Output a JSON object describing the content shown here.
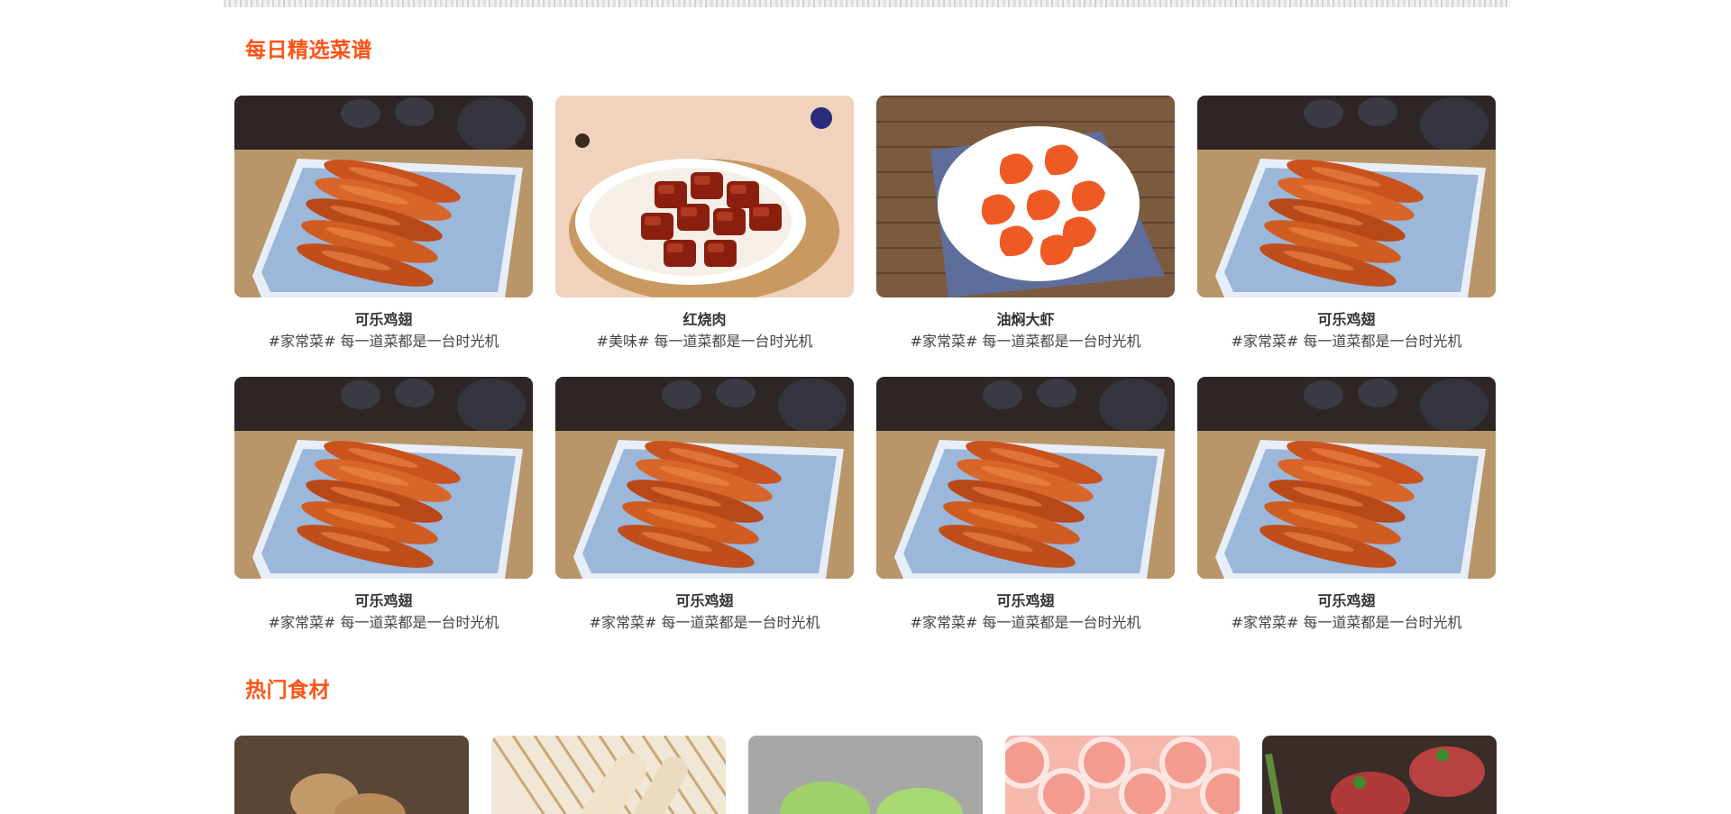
{
  "sections": {
    "recipes_title": "每日精选菜谱",
    "ingredients_title": "热门食材"
  },
  "recipes": [
    {
      "name": "可乐鸡翅",
      "desc": "#家常菜# 每一道菜都是一台时光机",
      "image": "cola-chicken-wings-photo"
    },
    {
      "name": "红烧肉",
      "desc": "#美味# 每一道菜都是一台时光机",
      "image": "braised-pork-photo"
    },
    {
      "name": "油焖大虾",
      "desc": "#家常菜# 每一道菜都是一台时光机",
      "image": "braised-prawns-photo"
    },
    {
      "name": "可乐鸡翅",
      "desc": "#家常菜# 每一道菜都是一台时光机",
      "image": "cola-chicken-wings-photo"
    },
    {
      "name": "可乐鸡翅",
      "desc": "#家常菜# 每一道菜都是一台时光机",
      "image": "cola-chicken-wings-photo"
    },
    {
      "name": "可乐鸡翅",
      "desc": "#家常菜# 每一道菜都是一台时光机",
      "image": "cola-chicken-wings-photo"
    },
    {
      "name": "可乐鸡翅",
      "desc": "#家常菜# 每一道菜都是一台时光机",
      "image": "cola-chicken-wings-photo"
    },
    {
      "name": "可乐鸡翅",
      "desc": "#家常菜# 每一道菜都是一台时光机",
      "image": "cola-chicken-wings-photo"
    }
  ],
  "ingredients": [
    {
      "image": "potato-photo"
    },
    {
      "image": "yam-photo"
    },
    {
      "image": "cabbage-photo"
    },
    {
      "image": "lamb-roll-photo"
    },
    {
      "image": "beef-steak-photo"
    }
  ],
  "colors": {
    "accent": "#ff5316",
    "text_dark": "#333333",
    "text_body": "#444444"
  }
}
